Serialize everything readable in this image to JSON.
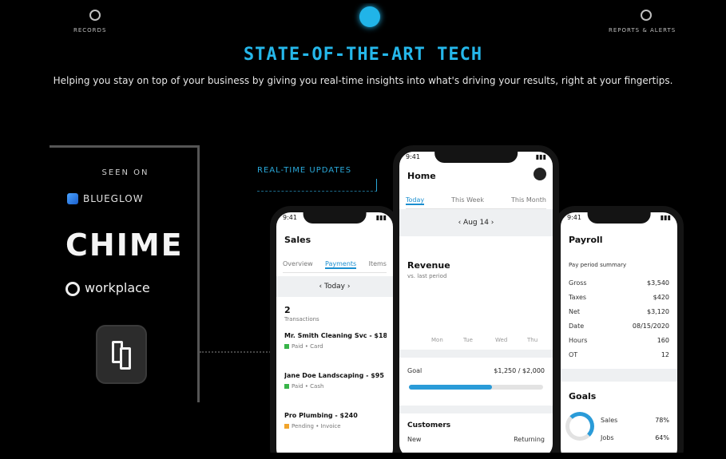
{
  "nav": {
    "left_label": "RECORDS",
    "right_label": "REPORTS & ALERTS"
  },
  "hero": {
    "title": "STATE-OF-THE-ART TECH",
    "subtitle": "Helping you stay on top of your business by giving you real-time insights into what's driving your results, right at your fingertips."
  },
  "sidebar": {
    "seen_on": "SEEN ON",
    "brands": [
      "BLUEGLOW",
      "CHIME",
      "workplace"
    ],
    "app_icon": "app-logo-icon"
  },
  "callout": {
    "text": "REAL-TIME UPDATES"
  },
  "phone_left": {
    "time": "9:41",
    "title": "Sales",
    "tabs": [
      "Overview",
      "Payments",
      "Items"
    ],
    "date": "‹ Today ›",
    "stat_value": "2",
    "stat_label": "Transactions",
    "items": [
      {
        "title": "Mr. Smith Cleaning Svc - $180",
        "sub": "Paid • Card"
      },
      {
        "title": "Jane Doe Landscaping - $95",
        "sub": "Paid • Cash"
      },
      {
        "title": "Pro Plumbing - $240",
        "sub": "Pending • Invoice"
      }
    ]
  },
  "phone_center": {
    "time": "9:41",
    "title": "Home",
    "tabs": [
      "Today",
      "This Week",
      "This Month"
    ],
    "date": "‹ Aug 14 ›",
    "metric_title": "Revenue",
    "metric_sub": "vs. last period",
    "x_labels": [
      "Mon",
      "Tue",
      "Wed",
      "Thu"
    ],
    "bar_values": [
      0,
      0,
      0,
      1
    ],
    "goal_label": "Goal",
    "goal_value": "$1,250 / $2,000",
    "goal_progress": 0.62,
    "bottom_title": "Customers",
    "bottom_row": [
      "New",
      "Returning"
    ]
  },
  "phone_right": {
    "time": "9:41",
    "title": "Payroll",
    "section": "Pay period summary",
    "rows": [
      {
        "label": "Gross",
        "value": "$3,540"
      },
      {
        "label": "Taxes",
        "value": "$420"
      },
      {
        "label": "Net",
        "value": "$3,120"
      },
      {
        "label": "Date",
        "value": "08/15/2020"
      },
      {
        "label": "Hours",
        "value": "160"
      },
      {
        "label": "OT",
        "value": "12"
      }
    ],
    "goals_title": "Goals",
    "goal_rows": [
      {
        "label": "Sales",
        "value": "78%"
      },
      {
        "label": "Jobs",
        "value": "64%"
      }
    ]
  },
  "colors": {
    "accent": "#21b4e8",
    "background": "#000000"
  }
}
